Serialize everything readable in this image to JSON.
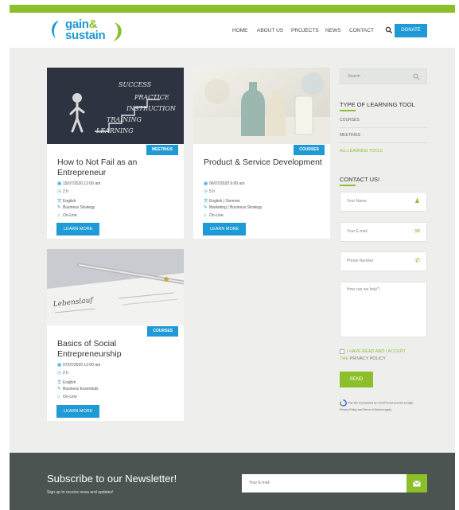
{
  "brand": {
    "line1": "gain",
    "amp": "&",
    "line2": "sustain",
    "green": "#8cbf2a",
    "blue": "#1f9ad6"
  },
  "nav": {
    "items": [
      "HOME",
      "ABOUT US",
      "PROJECTS",
      "NEWS",
      "CONTACT"
    ],
    "donate": "DONATE",
    "search_icon": "search-icon"
  },
  "cards": [
    {
      "badge": "MEETINGS",
      "title": "How to Not Fail as an Entrepreneur",
      "date": "15/07/2020 12:00 am",
      "duration": "2 h",
      "language": "English",
      "topic": "Business Strategy",
      "mode": "On-Line",
      "button": "LEARN MORE",
      "chalk": [
        "SUCCESS",
        "PRACTICE",
        "INSTRUCTION",
        "TRAINING",
        "LEARNING"
      ]
    },
    {
      "badge": "COURSES",
      "title": "Product & Service Development",
      "date": "06/07/2020 9:00 am",
      "duration": "5 h",
      "language": "English | German",
      "topic": "Marketing | Business Strategy",
      "mode": "On-Line",
      "button": "LEARN MORE"
    },
    {
      "badge": "COURSES",
      "title": "Basics of Social Entrepreneurship",
      "date": "07/07/2020 12:00 am",
      "duration": "2 h",
      "language": "English",
      "topic": "Business Essentials",
      "mode": "On-Line",
      "button": "LEARN MORE",
      "paper": "Lebenslauf"
    }
  ],
  "sidebar": {
    "search_placeholder": "Search",
    "tool_heading": "TYPE OF LEARNING TOOL",
    "tools": [
      "COURSES",
      "MEETINGS",
      "ALL LEARNING TOOLS"
    ],
    "contact_heading": "CONTACT US!",
    "name_placeholder": "Your Name",
    "email_placeholder": "Your E-mail",
    "phone_placeholder": "Phone Number",
    "message_placeholder": "How can we help?",
    "privacy_a": "I HAVE READ AND I ACCEPT",
    "privacy_b": "THE",
    "privacy_c": "PRIVACY POLICY",
    "send": "SEND",
    "recaptcha_a": "This site is protected by reCAPTCHA and the Google",
    "recaptcha_b": "Privacy Policy and Terms of Service apply."
  },
  "footer": {
    "title": "Subscribe to our Newsletter!",
    "subtitle": "Sign up to receive news and updates!",
    "email_placeholder": "Your E-mail"
  }
}
